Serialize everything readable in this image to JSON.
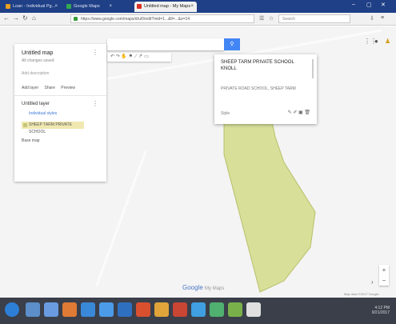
{
  "browser": {
    "tabs": [
      {
        "label": "Loan - Individual Pg...",
        "color": "#e8a020"
      },
      {
        "label": "Google Maps",
        "color": "#34a853"
      },
      {
        "label": "Untitled map - My Maps",
        "color": "#d93025"
      }
    ],
    "url": "https://www.google.com/maps/d/u/0/edit?mid=1...&ll=...&z=14",
    "search_placeholder": "Search"
  },
  "panel": {
    "title": "Untitled map",
    "subtitle": "All changes saved",
    "description": "Add description",
    "actions": [
      "Add layer",
      "Share",
      "Preview"
    ],
    "layer_title": "Untitled layer",
    "layer_style": "Individual styles",
    "feature": "SHEEP TARM PRIVATE SCHOOL",
    "basemap": "Base map"
  },
  "popup": {
    "title": "SHEEP TARM PRIVATE SCHOOL KNOLL",
    "address": "PRIVATE ROAD SCHOOL, SHEEP TARM",
    "style_label": "Style"
  },
  "map": {
    "google_logo": "Google",
    "footer_label": "My Maps",
    "copyright": "Map data ©2017 Google",
    "polygon_color": "#d8df99"
  },
  "taskbar": {
    "time": "4:12 PM",
    "date": "9/21/2017"
  }
}
